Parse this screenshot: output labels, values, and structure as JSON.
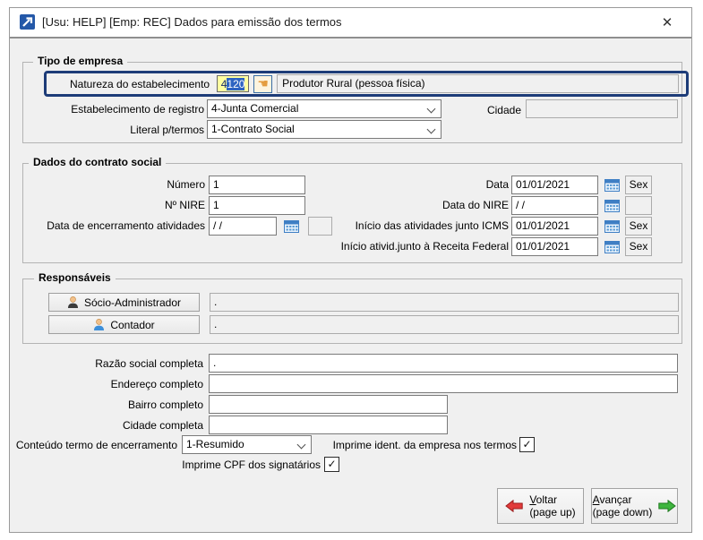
{
  "window": {
    "title": "[Usu: HELP] [Emp: REC] Dados para emissão dos termos"
  },
  "icons": {
    "close": "✕",
    "check": "✓",
    "hand": "☚"
  },
  "tipo_empresa": {
    "legend": "Tipo de empresa",
    "natureza": {
      "label": "Natureza do estabelecimento",
      "code_prefix": "4",
      "code_selected": "120",
      "description": "Produtor Rural (pessoa física)"
    },
    "estabelecimento_registro": {
      "label": "Estabelecimento de registro",
      "value": "4-Junta Comercial"
    },
    "cidade": {
      "label": "Cidade",
      "value": ""
    },
    "literal_termos": {
      "label": "Literal p/termos",
      "value": "1-Contrato Social"
    }
  },
  "contrato_social": {
    "legend": "Dados do contrato social",
    "numero": {
      "label": "Número",
      "value": "1"
    },
    "nire": {
      "label": "Nº NIRE",
      "value": "1"
    },
    "data_encerramento": {
      "label": "Data de encerramento atividades",
      "value": "/ /",
      "weekday": ""
    },
    "data": {
      "label": "Data",
      "value": "01/01/2021",
      "weekday": "Sex"
    },
    "data_nire": {
      "label": "Data do NIRE",
      "value": "/ /",
      "weekday": ""
    },
    "inicio_icms": {
      "label": "Início das atividades junto ICMS",
      "value": "01/01/2021",
      "weekday": "Sex"
    },
    "inicio_receita": {
      "label": "Início ativid.junto à Receita Federal",
      "value": "01/01/2021",
      "weekday": "Sex"
    }
  },
  "responsaveis": {
    "legend": "Responsáveis",
    "socio": {
      "button": "Sócio-Administrador",
      "value": "."
    },
    "contador": {
      "button": "Contador",
      "value": "."
    }
  },
  "detalhes": {
    "razao_social": {
      "label": "Razão social completa",
      "value": "."
    },
    "endereco": {
      "label": "Endereço completo",
      "value": ""
    },
    "bairro": {
      "label": "Bairro completo",
      "value": ""
    },
    "cidade": {
      "label": "Cidade completa",
      "value": ""
    },
    "conteudo_termo": {
      "label": "Conteúdo termo de encerramento",
      "value": "1-Resumido"
    },
    "imprime_ident": {
      "label": "Imprime ident. da empresa nos termos",
      "checked": true
    },
    "imprime_cpf": {
      "label": "Imprime CPF dos signatários",
      "checked": true
    }
  },
  "footer": {
    "voltar": {
      "label": "Voltar",
      "sublabel": "(page up)"
    },
    "avancar": {
      "label": "Avançar",
      "sublabel": "(page down)"
    }
  },
  "colors": {
    "highlight_border": "#1d3c78",
    "selection_blue": "#2e64c1",
    "field_yellow": "#ffffa0",
    "voltar_arrow": "#e23b3b",
    "avancar_arrow": "#3fb53f",
    "calendar_blue": "#3f7fc4",
    "titlebar_bg": "#ffffff",
    "dialog_bg": "#f0f0f0"
  }
}
